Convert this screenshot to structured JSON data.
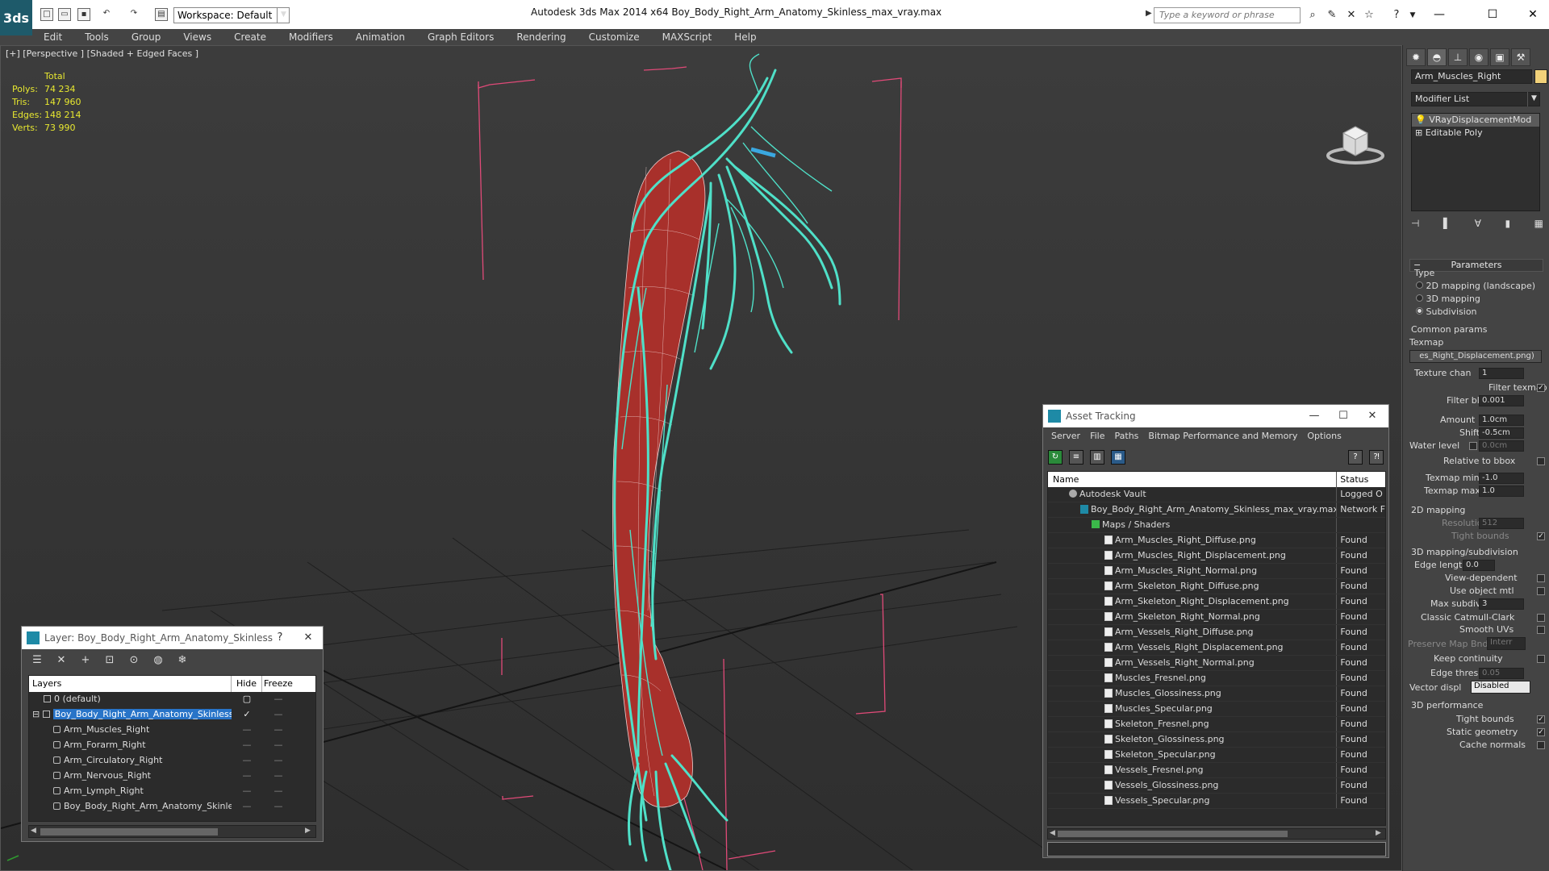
{
  "app": {
    "title": "Autodesk 3ds Max  2014 x64       Boy_Body_Right_Arm_Anatomy_Skinless_max_vray.max",
    "logo": "3ds",
    "workspace": "Workspace: Default",
    "search_placeholder": "Type a keyword or phrase"
  },
  "menu": [
    "Edit",
    "Tools",
    "Group",
    "Views",
    "Create",
    "Modifiers",
    "Animation",
    "Graph Editors",
    "Rendering",
    "Customize",
    "MAXScript",
    "Help"
  ],
  "viewport": {
    "label": "[+] [Perspective ] [Shaded + Edged Faces ]",
    "stats": {
      "header": "Total",
      "rows": [
        {
          "label": "Polys:",
          "value": "74 234"
        },
        {
          "label": "Tris:",
          "value": "147 960"
        },
        {
          "label": "Edges:",
          "value": "148 214"
        },
        {
          "label": "Verts:",
          "value": "73 990"
        }
      ]
    },
    "colors": {
      "muscle": "#a8302b",
      "nerve": "#4fe0c8",
      "wire": "#f0d0d0",
      "grid": "#1e1e1e",
      "bbox": "#e04a78"
    }
  },
  "command_panel": {
    "object_name": "Arm_Muscles_Right",
    "modifier_list": "Modifier List",
    "stack": [
      "VRayDisplacementMod",
      "Editable Poly"
    ],
    "rollout": "Parameters",
    "type_label": "Type",
    "type_options": [
      "2D mapping (landscape)",
      "3D mapping",
      "Subdivision"
    ],
    "common_params": "Common params",
    "texmap_label": "Texmap",
    "texmap_value": "es_Right_Displacement.png)",
    "texture_chan_label": "Texture chan",
    "texture_chan": "1",
    "filter_texmap": "Filter texmap",
    "filter_blur_label": "Filter blur",
    "filter_blur": "0.001",
    "amount_label": "Amount",
    "amount": "1.0cm",
    "shift_label": "Shift",
    "shift": "-0.5cm",
    "water_level_label": "Water level",
    "water_level": "0.0cm",
    "relative_bbox": "Relative to bbox",
    "texmap_min_label": "Texmap min",
    "texmap_min": "-1.0",
    "texmap_max_label": "Texmap max",
    "texmap_max": "1.0",
    "mapping2d": "2D mapping",
    "resolution_label": "Resolution",
    "resolution": "512",
    "tight_bounds_2d": "Tight bounds",
    "mapping3d": "3D mapping/subdivision",
    "edge_length_label": "Edge length",
    "edge_length": "0.0",
    "view_dependent": "View-dependent",
    "use_object_mtl": "Use object mtl",
    "max_subdivs_label": "Max subdivs",
    "max_subdivs": "3",
    "classic_catmull": "Classic Catmull-Clark",
    "smooth_uvs": "Smooth UVs",
    "preserve_map_bnd_label": "Preserve Map Bnd",
    "preserve_map_bnd": "Interr",
    "keep_continuity": "Keep continuity",
    "edge_thresh_label": "Edge thresh",
    "edge_thresh": "0.05",
    "vector_displ_label": "Vector displ",
    "vector_displ": "Disabled",
    "perf3d": "3D performance",
    "tight_bounds": "Tight bounds",
    "static_geometry": "Static geometry",
    "cache_normals": "Cache normals"
  },
  "asset_tracking": {
    "title": "Asset Tracking",
    "menu": [
      "Server",
      "File",
      "Paths",
      "Bitmap Performance and Memory",
      "Options"
    ],
    "columns": [
      "Name",
      "Status"
    ],
    "vault": {
      "name": "Autodesk Vault",
      "status": "Logged O"
    },
    "max_file": {
      "name": "Boy_Body_Right_Arm_Anatomy_Skinless_max_vray.max",
      "status": "Network F"
    },
    "group": "Maps / Shaders",
    "files": [
      {
        "name": "Arm_Muscles_Right_Diffuse.png",
        "status": "Found"
      },
      {
        "name": "Arm_Muscles_Right_Displacement.png",
        "status": "Found"
      },
      {
        "name": "Arm_Muscles_Right_Normal.png",
        "status": "Found"
      },
      {
        "name": "Arm_Skeleton_Right_Diffuse.png",
        "status": "Found"
      },
      {
        "name": "Arm_Skeleton_Right_Displacement.png",
        "status": "Found"
      },
      {
        "name": "Arm_Skeleton_Right_Normal.png",
        "status": "Found"
      },
      {
        "name": "Arm_Vessels_Right_Diffuse.png",
        "status": "Found"
      },
      {
        "name": "Arm_Vessels_Right_Displacement.png",
        "status": "Found"
      },
      {
        "name": "Arm_Vessels_Right_Normal.png",
        "status": "Found"
      },
      {
        "name": "Muscles_Fresnel.png",
        "status": "Found"
      },
      {
        "name": "Muscles_Glossiness.png",
        "status": "Found"
      },
      {
        "name": "Muscles_Specular.png",
        "status": "Found"
      },
      {
        "name": "Skeleton_Fresnel.png",
        "status": "Found"
      },
      {
        "name": "Skeleton_Glossiness.png",
        "status": "Found"
      },
      {
        "name": "Skeleton_Specular.png",
        "status": "Found"
      },
      {
        "name": "Vessels_Fresnel.png",
        "status": "Found"
      },
      {
        "name": "Vessels_Glossiness.png",
        "status": "Found"
      },
      {
        "name": "Vessels_Specular.png",
        "status": "Found"
      }
    ]
  },
  "layer_dialog": {
    "title": "Layer: Boy_Body_Right_Arm_Anatomy_Skinless",
    "help": "?",
    "columns": [
      "Layers",
      "Hide",
      "Freeze"
    ],
    "default_layer": "0 (default)",
    "selected_layer": "Boy_Body_Right_Arm_Anatomy_Skinless",
    "objects": [
      "Arm_Muscles_Right",
      "Arm_Forarm_Right",
      "Arm_Circulatory_Right",
      "Arm_Nervous_Right",
      "Arm_Lymph_Right",
      "Boy_Body_Right_Arm_Anatomy_Skinless"
    ],
    "dash": "—"
  }
}
